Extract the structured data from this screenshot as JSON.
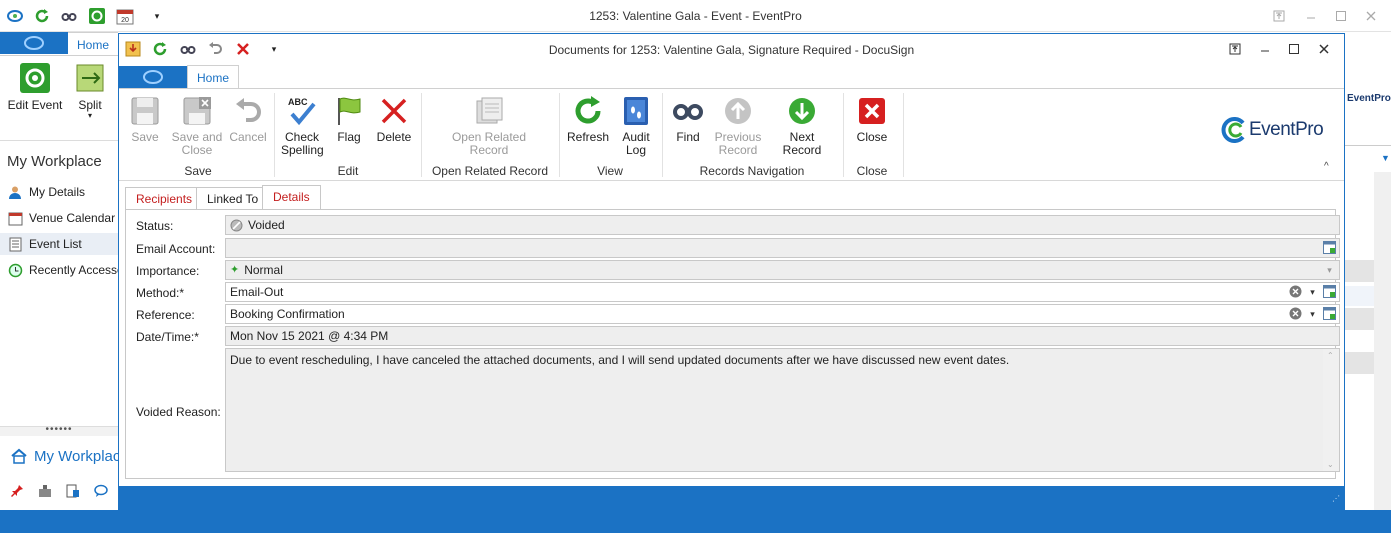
{
  "outer": {
    "title": "1253: Valentine Gala - Event - EventPro",
    "home_tab": "Home",
    "ribbon": {
      "edit_event": "Edit Event",
      "split": "Split"
    },
    "workplace_title": "My Workplace",
    "nav_items": [
      "My Details",
      "Venue Calendar",
      "Event List",
      "Recently Accessed"
    ],
    "splitter": "••••••",
    "bottom_workplace": "My Workplace",
    "brand_partial": "EventPro"
  },
  "dialog": {
    "title": "Documents for 1253: Valentine Gala, Signature Required - DocuSign",
    "home_tab": "Home",
    "ribbon": {
      "save": "Save",
      "save_close": [
        "Save and",
        "Close"
      ],
      "cancel": "Cancel",
      "check_spelling": [
        "Check",
        "Spelling"
      ],
      "abc": "ABC",
      "flag": "Flag",
      "delete": "Delete",
      "open_related": [
        "Open Related",
        "Record"
      ],
      "refresh": "Refresh",
      "audit_log": [
        "Audit",
        "Log"
      ],
      "find": "Find",
      "previous_record": [
        "Previous",
        "Record"
      ],
      "next_record": "Next Record",
      "close": "Close"
    },
    "groups": {
      "save": "Save",
      "edit": "Edit",
      "open_related": "Open Related Record",
      "view": "View",
      "records_navigation": "Records Navigation",
      "close": "Close"
    },
    "brand": "EventPro",
    "tabs": [
      "Recipients",
      "Linked To",
      "Details"
    ],
    "active_tab": "Details",
    "fields": {
      "status": {
        "label": "Status:",
        "value": "Voided"
      },
      "email_account": {
        "label": "Email Account:",
        "value": ""
      },
      "importance": {
        "label": "Importance:",
        "value": "Normal"
      },
      "method": {
        "label": "Method:*",
        "value": "Email-Out"
      },
      "reference": {
        "label": "Reference:",
        "value": "Booking Confirmation"
      },
      "datetime": {
        "label": "Date/Time:*",
        "value": "Mon Nov 15 2021 @ 4:34 PM"
      },
      "voided_reason": {
        "label": "Voided Reason:",
        "value": "Due to event rescheduling, I have canceled the attached documents, and I will send updated documents after we have discussed new event dates."
      }
    }
  },
  "colors": {
    "accent": "#1b72c4",
    "green": "#2e9e2e",
    "red": "#d62020",
    "disabled": "#9a9a9a"
  }
}
